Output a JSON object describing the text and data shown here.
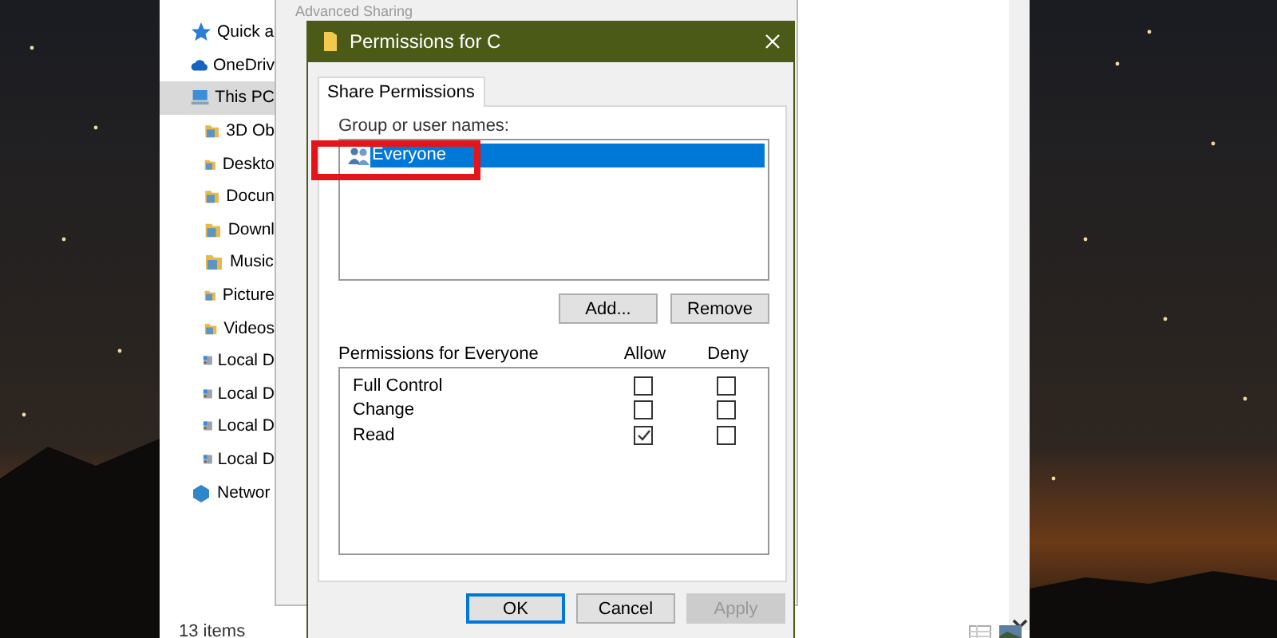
{
  "explorer": {
    "nav_items": [
      {
        "label": "Quick a",
        "kind": "star",
        "selected": false
      },
      {
        "label": "OneDriv",
        "kind": "cloud",
        "selected": false
      },
      {
        "label": "This PC",
        "kind": "pc",
        "selected": true
      },
      {
        "label": "3D Ob",
        "kind": "folder",
        "selected": false
      },
      {
        "label": "Deskto",
        "kind": "folder",
        "selected": false
      },
      {
        "label": "Docun",
        "kind": "folder",
        "selected": false
      },
      {
        "label": "Downl",
        "kind": "folder",
        "selected": false
      },
      {
        "label": "Music",
        "kind": "folder",
        "selected": false
      },
      {
        "label": "Picture",
        "kind": "folder",
        "selected": false
      },
      {
        "label": "Videos",
        "kind": "folder",
        "selected": false
      },
      {
        "label": "Local D",
        "kind": "drive",
        "selected": false
      },
      {
        "label": "Local D",
        "kind": "drive",
        "selected": false
      },
      {
        "label": "Local D",
        "kind": "drive",
        "selected": false
      },
      {
        "label": "Local D",
        "kind": "drive",
        "selected": false
      },
      {
        "label": "Networ",
        "kind": "network",
        "selected": false
      }
    ],
    "status": "13 items"
  },
  "background_window": {
    "title": "Advanced Sharing"
  },
  "dialog": {
    "title": "Permissions for C",
    "tabs": [
      {
        "label": "Share Permissions",
        "selected": true
      }
    ],
    "group_label": "Group or user names:",
    "users": [
      {
        "name": "Everyone",
        "selected": true,
        "highlighted": true
      }
    ],
    "user_buttons": [
      "Add...",
      "Remove"
    ],
    "permissions_label": "Permissions for Everyone",
    "columns": [
      "Allow",
      "Deny"
    ],
    "permissions": [
      {
        "name": "Full Control",
        "allow": false,
        "deny": false
      },
      {
        "name": "Change",
        "allow": false,
        "deny": false
      },
      {
        "name": "Read",
        "allow": true,
        "deny": false
      }
    ],
    "buttons": [
      {
        "label": "OK",
        "default": true,
        "disabled": false
      },
      {
        "label": "Cancel",
        "default": false,
        "disabled": false
      },
      {
        "label": "Apply",
        "default": false,
        "disabled": true
      }
    ]
  }
}
